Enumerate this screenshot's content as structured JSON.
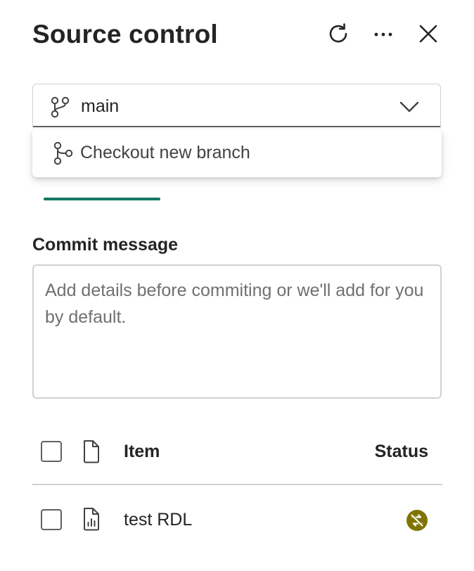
{
  "header": {
    "title": "Source control",
    "icons": {
      "refresh": "refresh-icon",
      "more": "more-horizontal-icon",
      "close": "close-icon"
    }
  },
  "branch": {
    "selected": "main",
    "icon": "branch-icon",
    "dropdown_icon": "chevron-down-icon"
  },
  "dropdown": {
    "items": [
      {
        "label": "Checkout new branch",
        "icon": "branch-fork-icon"
      }
    ]
  },
  "tabs": {
    "active_accent": "#117865"
  },
  "commit": {
    "label": "Commit message",
    "value": "",
    "placeholder": "Add details before commiting or we'll add for you by default."
  },
  "table": {
    "columns": {
      "item": "Item",
      "status": "Status"
    },
    "rows": [
      {
        "name": "test RDL",
        "icon": "report-file-icon",
        "status_icon": "conflict-status-icon",
        "status_color": "#817400"
      }
    ]
  }
}
